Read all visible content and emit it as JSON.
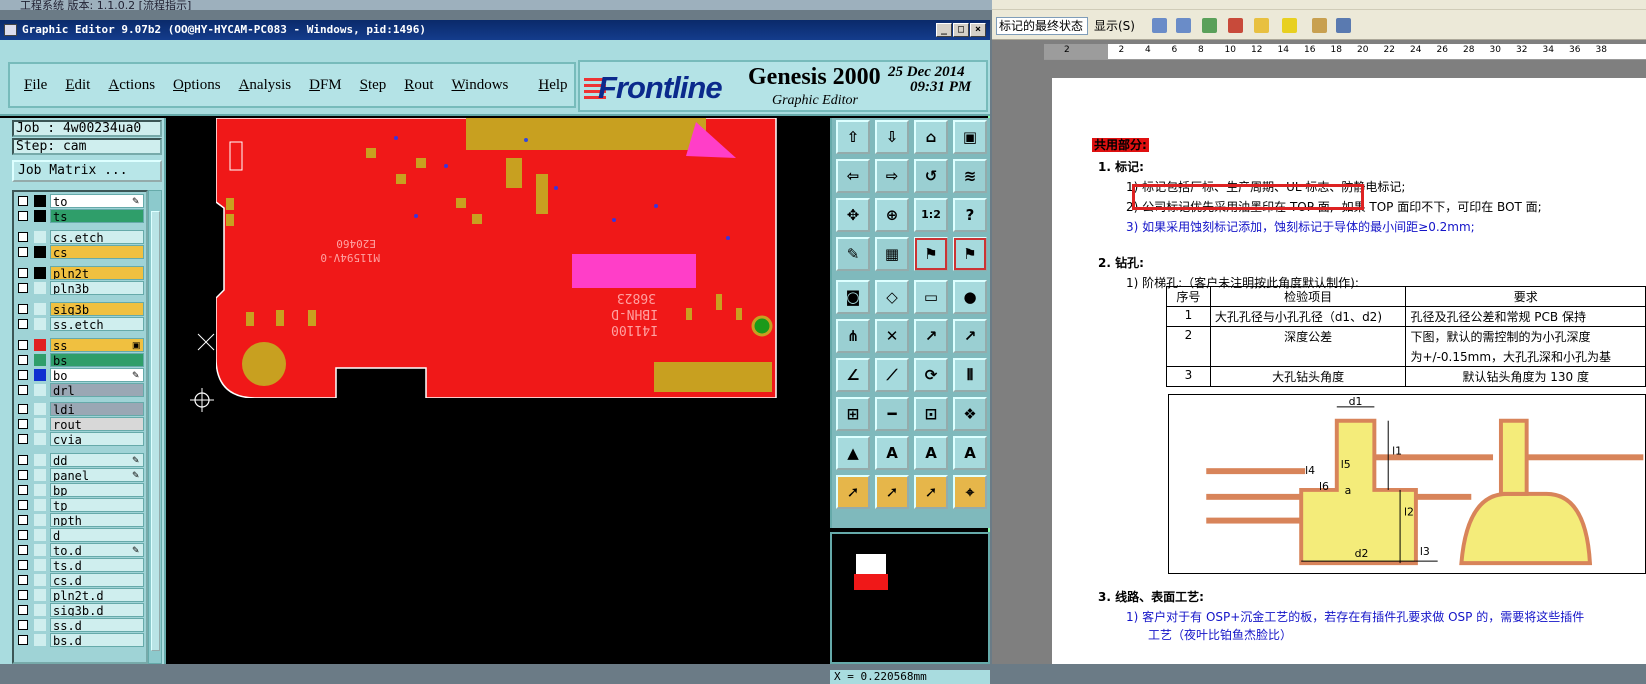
{
  "background_strip": {
    "text": "工程系统    版本: 1.1.0.2    [流程指示]"
  },
  "genesis": {
    "title": "Graphic Editor 9.07b2 (OO@HY-HYCAM-PC083 - Windows, pid:1496)",
    "window_buttons": {
      "minimize": "_",
      "maximize": "□",
      "close": "×"
    },
    "menu": [
      "File",
      "Edit",
      "Actions",
      "Options",
      "Analysis",
      "DFM",
      "Step",
      "Rout",
      "Windows",
      "Help"
    ],
    "brand": {
      "frontline": "Frontline",
      "product": "Genesis 2000",
      "subtitle": "Graphic Editor",
      "date": "25 Dec 2014",
      "time": "09:31 PM"
    },
    "job": "Job : 4w00234ua0",
    "step": "Step: cam",
    "job_matrix": "Job Matrix ...",
    "layers": [
      {
        "name": "to",
        "color": "#ffffff",
        "swatch": "#000000",
        "flag": "✎"
      },
      {
        "name": "ts",
        "color": "#2f9e6a",
        "swatch": "#000000",
        "flag": ""
      },
      {
        "name": "cs.etch",
        "color": "#cfeeee",
        "swatch": "#cfeeee",
        "flag": ""
      },
      {
        "name": "cs",
        "color": "#f0c040",
        "swatch": "#000000",
        "flag": ""
      },
      {
        "name": "pln2t",
        "color": "#f0c040",
        "swatch": "#000000",
        "flag": ""
      },
      {
        "name": "pln3b",
        "color": "#cfeeee",
        "swatch": "#cfeeee",
        "flag": ""
      },
      {
        "name": "sig3b",
        "color": "#f0c040",
        "swatch": "#cfeeee",
        "flag": ""
      },
      {
        "name": "ss.etch",
        "color": "#cfeeee",
        "swatch": "#cfeeee",
        "flag": ""
      },
      {
        "name": "ss",
        "color": "#f0c040",
        "swatch": "#e02020",
        "flag": "▣"
      },
      {
        "name": "bs",
        "color": "#2f9e6a",
        "swatch": "#2f9e6a",
        "flag": ""
      },
      {
        "name": "bo",
        "color": "#ffffff",
        "swatch": "#1030d0",
        "flag": "✎"
      },
      {
        "name": "drl",
        "color": "#9aa7b4",
        "swatch": "#cfeeee",
        "flag": ""
      },
      {
        "name": "ldi",
        "color": "#9aa7b4",
        "swatch": "#cfeeee",
        "flag": ""
      },
      {
        "name": "rout",
        "color": "#d8d8d8",
        "swatch": "#cfeeee",
        "flag": ""
      },
      {
        "name": "cvia",
        "color": "#cfeeee",
        "swatch": "#cfeeee",
        "flag": ""
      },
      {
        "name": "dd",
        "color": "#cfeeee",
        "swatch": "#cfeeee",
        "flag": "✎"
      },
      {
        "name": "panel",
        "color": "#cfeeee",
        "swatch": "#cfeeee",
        "flag": "✎"
      },
      {
        "name": "bp",
        "color": "#cfeeee",
        "swatch": "#cfeeee",
        "flag": ""
      },
      {
        "name": "tp",
        "color": "#cfeeee",
        "swatch": "#cfeeee",
        "flag": ""
      },
      {
        "name": "npth",
        "color": "#cfeeee",
        "swatch": "#cfeeee",
        "flag": ""
      },
      {
        "name": "d",
        "color": "#cfeeee",
        "swatch": "#cfeeee",
        "flag": ""
      },
      {
        "name": "to.d",
        "color": "#cfeeee",
        "swatch": "#cfeeee",
        "flag": "✎"
      },
      {
        "name": "ts.d",
        "color": "#cfeeee",
        "swatch": "#cfeeee",
        "flag": ""
      },
      {
        "name": "cs.d",
        "color": "#cfeeee",
        "swatch": "#cfeeee",
        "flag": ""
      },
      {
        "name": "pln2t.d",
        "color": "#cfeeee",
        "swatch": "#cfeeee",
        "flag": ""
      },
      {
        "name": "sig3b.d",
        "color": "#cfeeee",
        "swatch": "#cfeeee",
        "flag": ""
      },
      {
        "name": "ss.d",
        "color": "#cfeeee",
        "swatch": "#cfeeee",
        "flag": ""
      },
      {
        "name": "bs.d",
        "color": "#cfeeee",
        "swatch": "#cfeeee",
        "flag": ""
      }
    ],
    "canvas_text": {
      "e1": "E20460",
      "e2": "M11594V-0",
      "m1": "36823",
      "m2": "IBHN-D",
      "m3": "I41100"
    },
    "tools": [
      {
        "icon": "⇧",
        "style": "n"
      },
      {
        "icon": "⇩",
        "style": "n"
      },
      {
        "icon": "⌂",
        "style": "n"
      },
      {
        "icon": "▣",
        "style": "n"
      },
      {
        "icon": "⇦",
        "style": "n"
      },
      {
        "icon": "⇨",
        "style": "n"
      },
      {
        "icon": "↺",
        "style": "n"
      },
      {
        "icon": "≋",
        "style": "n"
      },
      {
        "icon": "✥",
        "style": "n"
      },
      {
        "icon": "⊕",
        "style": "n"
      },
      {
        "icon": "1:2",
        "style": "n"
      },
      {
        "icon": "?",
        "style": "n"
      },
      {
        "icon": "✎",
        "style": "n"
      },
      {
        "icon": "▦",
        "style": "n"
      },
      {
        "icon": "⚑",
        "style": "r"
      },
      {
        "icon": "⚑",
        "style": "r"
      },
      {
        "icon": "◙",
        "style": "n"
      },
      {
        "icon": "◇",
        "style": "n"
      },
      {
        "icon": "▭",
        "style": "n"
      },
      {
        "icon": "●",
        "style": "n"
      },
      {
        "icon": "⋔",
        "style": "n"
      },
      {
        "icon": "✕",
        "style": "n"
      },
      {
        "icon": "↗",
        "style": "n"
      },
      {
        "icon": "↗",
        "style": "n"
      },
      {
        "icon": "∠",
        "style": "n"
      },
      {
        "icon": "⟋",
        "style": "n"
      },
      {
        "icon": "⟳",
        "style": "n"
      },
      {
        "icon": "⫴",
        "style": "n"
      },
      {
        "icon": "⊞",
        "style": "n"
      },
      {
        "icon": "━",
        "style": "n"
      },
      {
        "icon": "⊡",
        "style": "n"
      },
      {
        "icon": "❖",
        "style": "n"
      },
      {
        "icon": "▲",
        "style": "n"
      },
      {
        "icon": "A",
        "style": "n"
      },
      {
        "icon": "A",
        "style": "n"
      },
      {
        "icon": "A",
        "style": "n"
      },
      {
        "icon": "➚",
        "style": "y"
      },
      {
        "icon": "➚",
        "style": "y"
      },
      {
        "icon": "➚",
        "style": "y"
      },
      {
        "icon": "⌖",
        "style": "y"
      }
    ],
    "coord": "X = 0.220568mm"
  },
  "word": {
    "style_select": "标记的最终状态",
    "show_label": "显示(S)",
    "ruler_numbers": [
      "2",
      "2",
      "4",
      "6",
      "8",
      "10",
      "12",
      "14",
      "16",
      "18",
      "20",
      "22",
      "24",
      "26",
      "28",
      "30",
      "32",
      "34",
      "36",
      "38"
    ],
    "heading_common": "共用部分:",
    "s1_title": "1.  标记:",
    "s1_i1": "1)  标记包括厂标、生产周期、UL 标志、防静电标记;",
    "s1_i2a": "2)  公司标记优先采用油墨印在 TOP 面,",
    "s1_i2b": "如果 TOP 面印不下，可印在 BOT 面;",
    "s1_i3": "3)  如果采用蚀刻标记添加，蚀刻标记于导体的最小间距≥0.2mm;",
    "s2_title": "2.  钻孔:",
    "s2_i1": "1)  阶梯孔:（客户未注明按此角度默认制作):",
    "table": {
      "headers": [
        "序号",
        "检验项目",
        "要求"
      ],
      "rows": [
        [
          "1",
          "大孔孔径与小孔孔径（d1、d2)",
          "孔径及孔径公差和常规 PCB 保持"
        ],
        [
          "2",
          "深度公差",
          "下图，默认的需控制的为小孔深度"
        ],
        [
          "",
          "",
          "为+/-0.15mm，大孔孔深和小孔为基"
        ],
        [
          "3",
          "大孔钻头角度",
          "默认钻头角度为 130 度"
        ]
      ]
    },
    "diagram_labels": {
      "d1": "d1",
      "l1": "l1",
      "l2": "l2",
      "l3": "l3",
      "l4": "l4",
      "l5": "l5",
      "l6": "l6",
      "a": "a",
      "d2": "d2"
    },
    "s3_title": "3.  线路、表面工艺:",
    "s3_i1": "1)  客户对于有 OSP+沉金工艺的板，若存在有插件孔要求做 OSP 的，需要将这些插件",
    "s3_i1b": "工艺（夜叶比铂鱼杰脸比）"
  }
}
